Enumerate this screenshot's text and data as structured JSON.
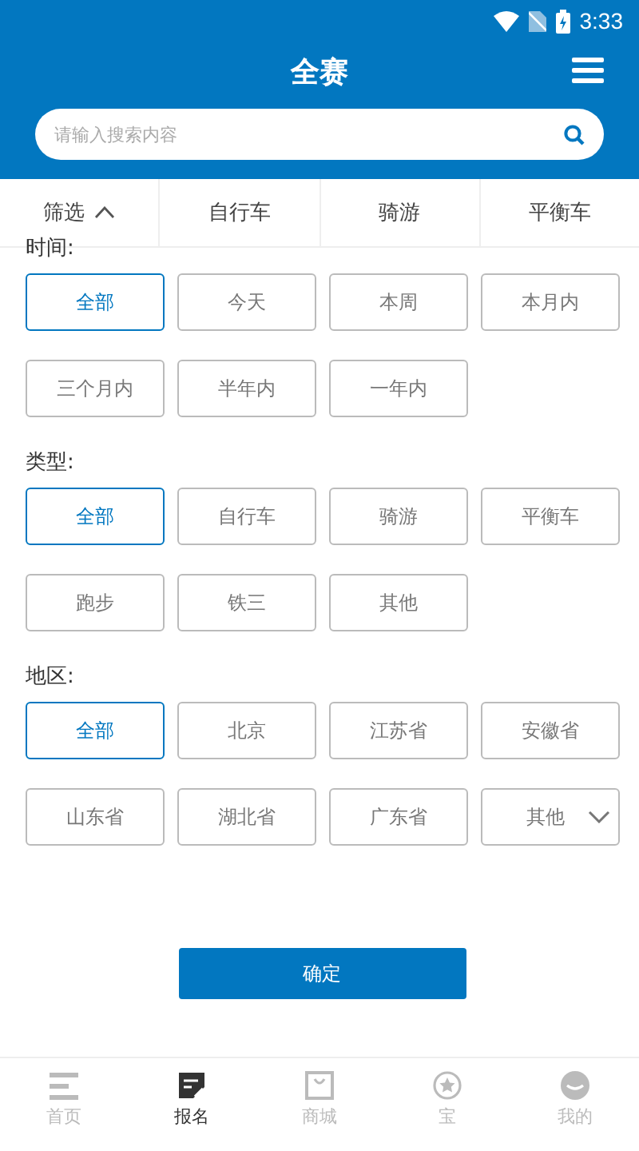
{
  "status_bar": {
    "time": "3:33"
  },
  "header": {
    "title": "全赛",
    "search": {
      "placeholder": "请输入搜索内容"
    }
  },
  "filter_tabs": [
    {
      "label": "筛选",
      "expanded": true,
      "kind": "filter"
    },
    {
      "label": "自行车",
      "kind": "tab"
    },
    {
      "label": "骑游",
      "kind": "tab"
    },
    {
      "label": "平衡车",
      "kind": "tab"
    }
  ],
  "sections": [
    {
      "label": "时间:",
      "options": [
        {
          "label": "全部",
          "selected": true,
          "kind": "option"
        },
        {
          "label": "今天",
          "selected": false,
          "kind": "option"
        },
        {
          "label": "本周",
          "selected": false,
          "kind": "option"
        },
        {
          "label": "本月内",
          "selected": false,
          "kind": "option"
        },
        {
          "label": "三个月内",
          "selected": false,
          "kind": "option"
        },
        {
          "label": "半年内",
          "selected": false,
          "kind": "option"
        },
        {
          "label": "一年内",
          "selected": false,
          "kind": "option"
        }
      ]
    },
    {
      "label": "类型:",
      "options": [
        {
          "label": "全部",
          "selected": true,
          "kind": "option"
        },
        {
          "label": "自行车",
          "selected": false,
          "kind": "option"
        },
        {
          "label": "骑游",
          "selected": false,
          "kind": "option"
        },
        {
          "label": "平衡车",
          "selected": false,
          "kind": "option"
        },
        {
          "label": "跑步",
          "selected": false,
          "kind": "option"
        },
        {
          "label": "铁三",
          "selected": false,
          "kind": "option"
        },
        {
          "label": "其他",
          "selected": false,
          "kind": "option"
        }
      ]
    },
    {
      "label": "地区:",
      "options": [
        {
          "label": "全部",
          "selected": true,
          "kind": "option"
        },
        {
          "label": "北京",
          "selected": false,
          "kind": "option"
        },
        {
          "label": "江苏省",
          "selected": false,
          "kind": "option"
        },
        {
          "label": "安徽省",
          "selected": false,
          "kind": "option"
        },
        {
          "label": "山东省",
          "selected": false,
          "kind": "option"
        },
        {
          "label": "湖北省",
          "selected": false,
          "kind": "option"
        },
        {
          "label": "广东省",
          "selected": false,
          "kind": "option"
        },
        {
          "label": "其他",
          "selected": false,
          "kind": "dropdown"
        }
      ]
    }
  ],
  "confirm_button": "确定",
  "bottom_nav": [
    {
      "label": "首页",
      "kind": "list",
      "selected": false
    },
    {
      "label": "报名",
      "kind": "edit",
      "selected": true
    },
    {
      "label": "商城",
      "kind": "bag",
      "selected": false
    },
    {
      "label": "宝",
      "kind": "star",
      "selected": false
    },
    {
      "label": "我的",
      "kind": "person",
      "selected": false
    }
  ]
}
